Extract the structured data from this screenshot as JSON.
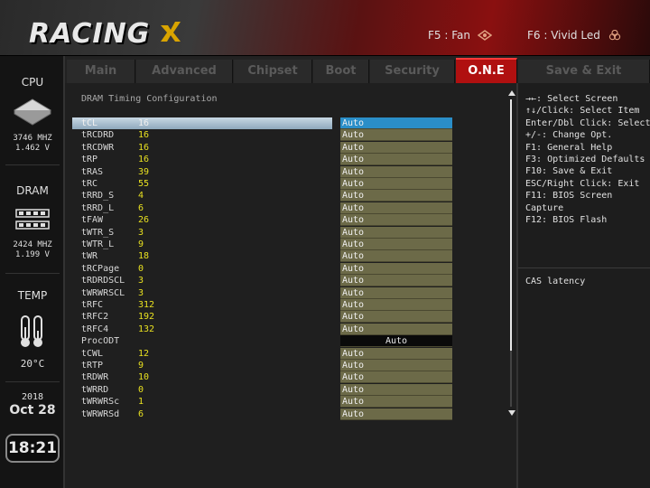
{
  "brand": {
    "logo_text": "RACING"
  },
  "hotkeys": [
    {
      "label": "F5 : Fan"
    },
    {
      "label": "F6 : Vivid Led"
    }
  ],
  "sidebar": {
    "cpu": {
      "label": "CPU",
      "freq": "3746 MHZ",
      "volt": "1.462 V"
    },
    "dram": {
      "label": "DRAM",
      "freq": "2424 MHZ",
      "volt": "1.199 V"
    },
    "temp": {
      "label": "TEMP",
      "value": "20°C"
    },
    "date": {
      "year": "2018",
      "day": "Oct 28"
    },
    "clock": "18:21"
  },
  "tabs": [
    {
      "label": "Main",
      "active": false
    },
    {
      "label": "Advanced",
      "active": false
    },
    {
      "label": "Chipset",
      "active": false
    },
    {
      "label": "Boot",
      "active": false
    },
    {
      "label": "Security",
      "active": false
    },
    {
      "label": "O.N.E",
      "active": true
    },
    {
      "label": "Save & Exit",
      "active": false
    }
  ],
  "main": {
    "section_title": "DRAM Timing Configuration",
    "rows": [
      {
        "name": "tCL",
        "value": "16",
        "option": "Auto"
      },
      {
        "name": "tRCDRD",
        "value": "16",
        "option": "Auto"
      },
      {
        "name": "tRCDWR",
        "value": "16",
        "option": "Auto"
      },
      {
        "name": "tRP",
        "value": "16",
        "option": "Auto"
      },
      {
        "name": "tRAS",
        "value": "39",
        "option": "Auto"
      },
      {
        "name": "tRC",
        "value": "55",
        "option": "Auto"
      },
      {
        "name": "tRRD_S",
        "value": "4",
        "option": "Auto"
      },
      {
        "name": "tRRD_L",
        "value": "6",
        "option": "Auto"
      },
      {
        "name": "tFAW",
        "value": "26",
        "option": "Auto"
      },
      {
        "name": "tWTR_S",
        "value": "3",
        "option": "Auto"
      },
      {
        "name": "tWTR_L",
        "value": "9",
        "option": "Auto"
      },
      {
        "name": "tWR",
        "value": "18",
        "option": "Auto"
      },
      {
        "name": "tRCPage",
        "value": "0",
        "option": "Auto"
      },
      {
        "name": "tRDRDSCL",
        "value": "3",
        "option": "Auto"
      },
      {
        "name": "tWRWRSCL",
        "value": "3",
        "option": "Auto"
      },
      {
        "name": "tRFC",
        "value": "312",
        "option": "Auto"
      },
      {
        "name": "tRFC2",
        "value": "192",
        "option": "Auto"
      },
      {
        "name": "tRFC4",
        "value": "132",
        "option": "Auto"
      },
      {
        "name": "ProcODT",
        "value": "",
        "option": "Auto"
      },
      {
        "name": "tCWL",
        "value": "12",
        "option": "Auto"
      },
      {
        "name": "tRTP",
        "value": "9",
        "option": "Auto"
      },
      {
        "name": "tRDWR",
        "value": "10",
        "option": "Auto"
      },
      {
        "name": "tWRRD",
        "value": "0",
        "option": "Auto"
      },
      {
        "name": "tWRWRSc",
        "value": "1",
        "option": "Auto"
      },
      {
        "name": "tWRWRSd",
        "value": "6",
        "option": "Auto"
      }
    ]
  },
  "help": {
    "lines": [
      "→←: Select Screen",
      "↑↓/Click: Select Item",
      "Enter/Dbl Click: Select",
      "+/-: Change Opt.",
      "F1: General Help",
      "F3: Optimized Defaults",
      "F10: Save & Exit",
      "ESC/Right Click: Exit",
      "F11: BIOS Screen",
      "Capture",
      "F12: BIOS Flash"
    ],
    "description": "CAS latency"
  },
  "colors": {
    "accent": "#b01010",
    "selected_option": "#2a8ec8",
    "value_yellow": "#e8e020"
  }
}
